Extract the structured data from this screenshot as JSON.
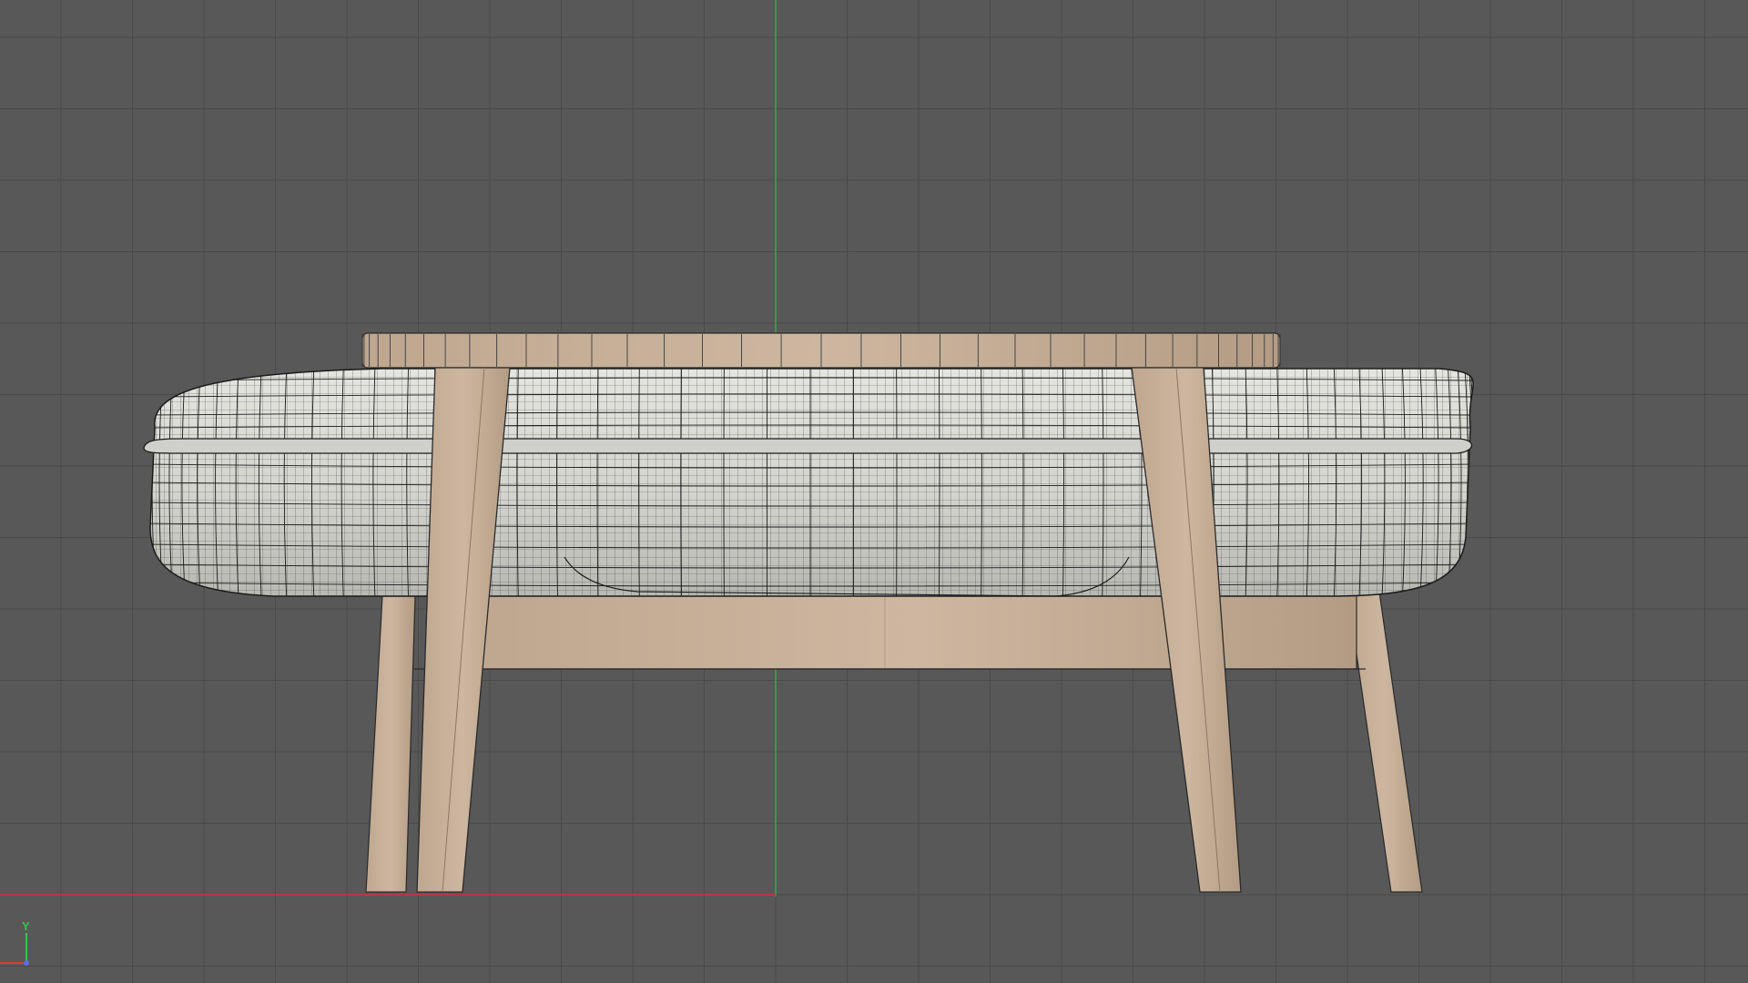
{
  "viewport": {
    "background": "#585858",
    "grid_color": "#4a4a4a",
    "x_axis_color": "#c8343a",
    "y_axis_color": "#2fae3a",
    "axis_gizmo": {
      "y_label": "Y",
      "y_color": "#3ac24a",
      "x_color": "#d0403a",
      "z_color": "#5a6fe0"
    }
  },
  "model": {
    "wood_color": "#c9b29a",
    "wood_dark": "#a8907a",
    "cushion_color": "#d6d6d2",
    "wire_color": "#1a1a1a"
  }
}
